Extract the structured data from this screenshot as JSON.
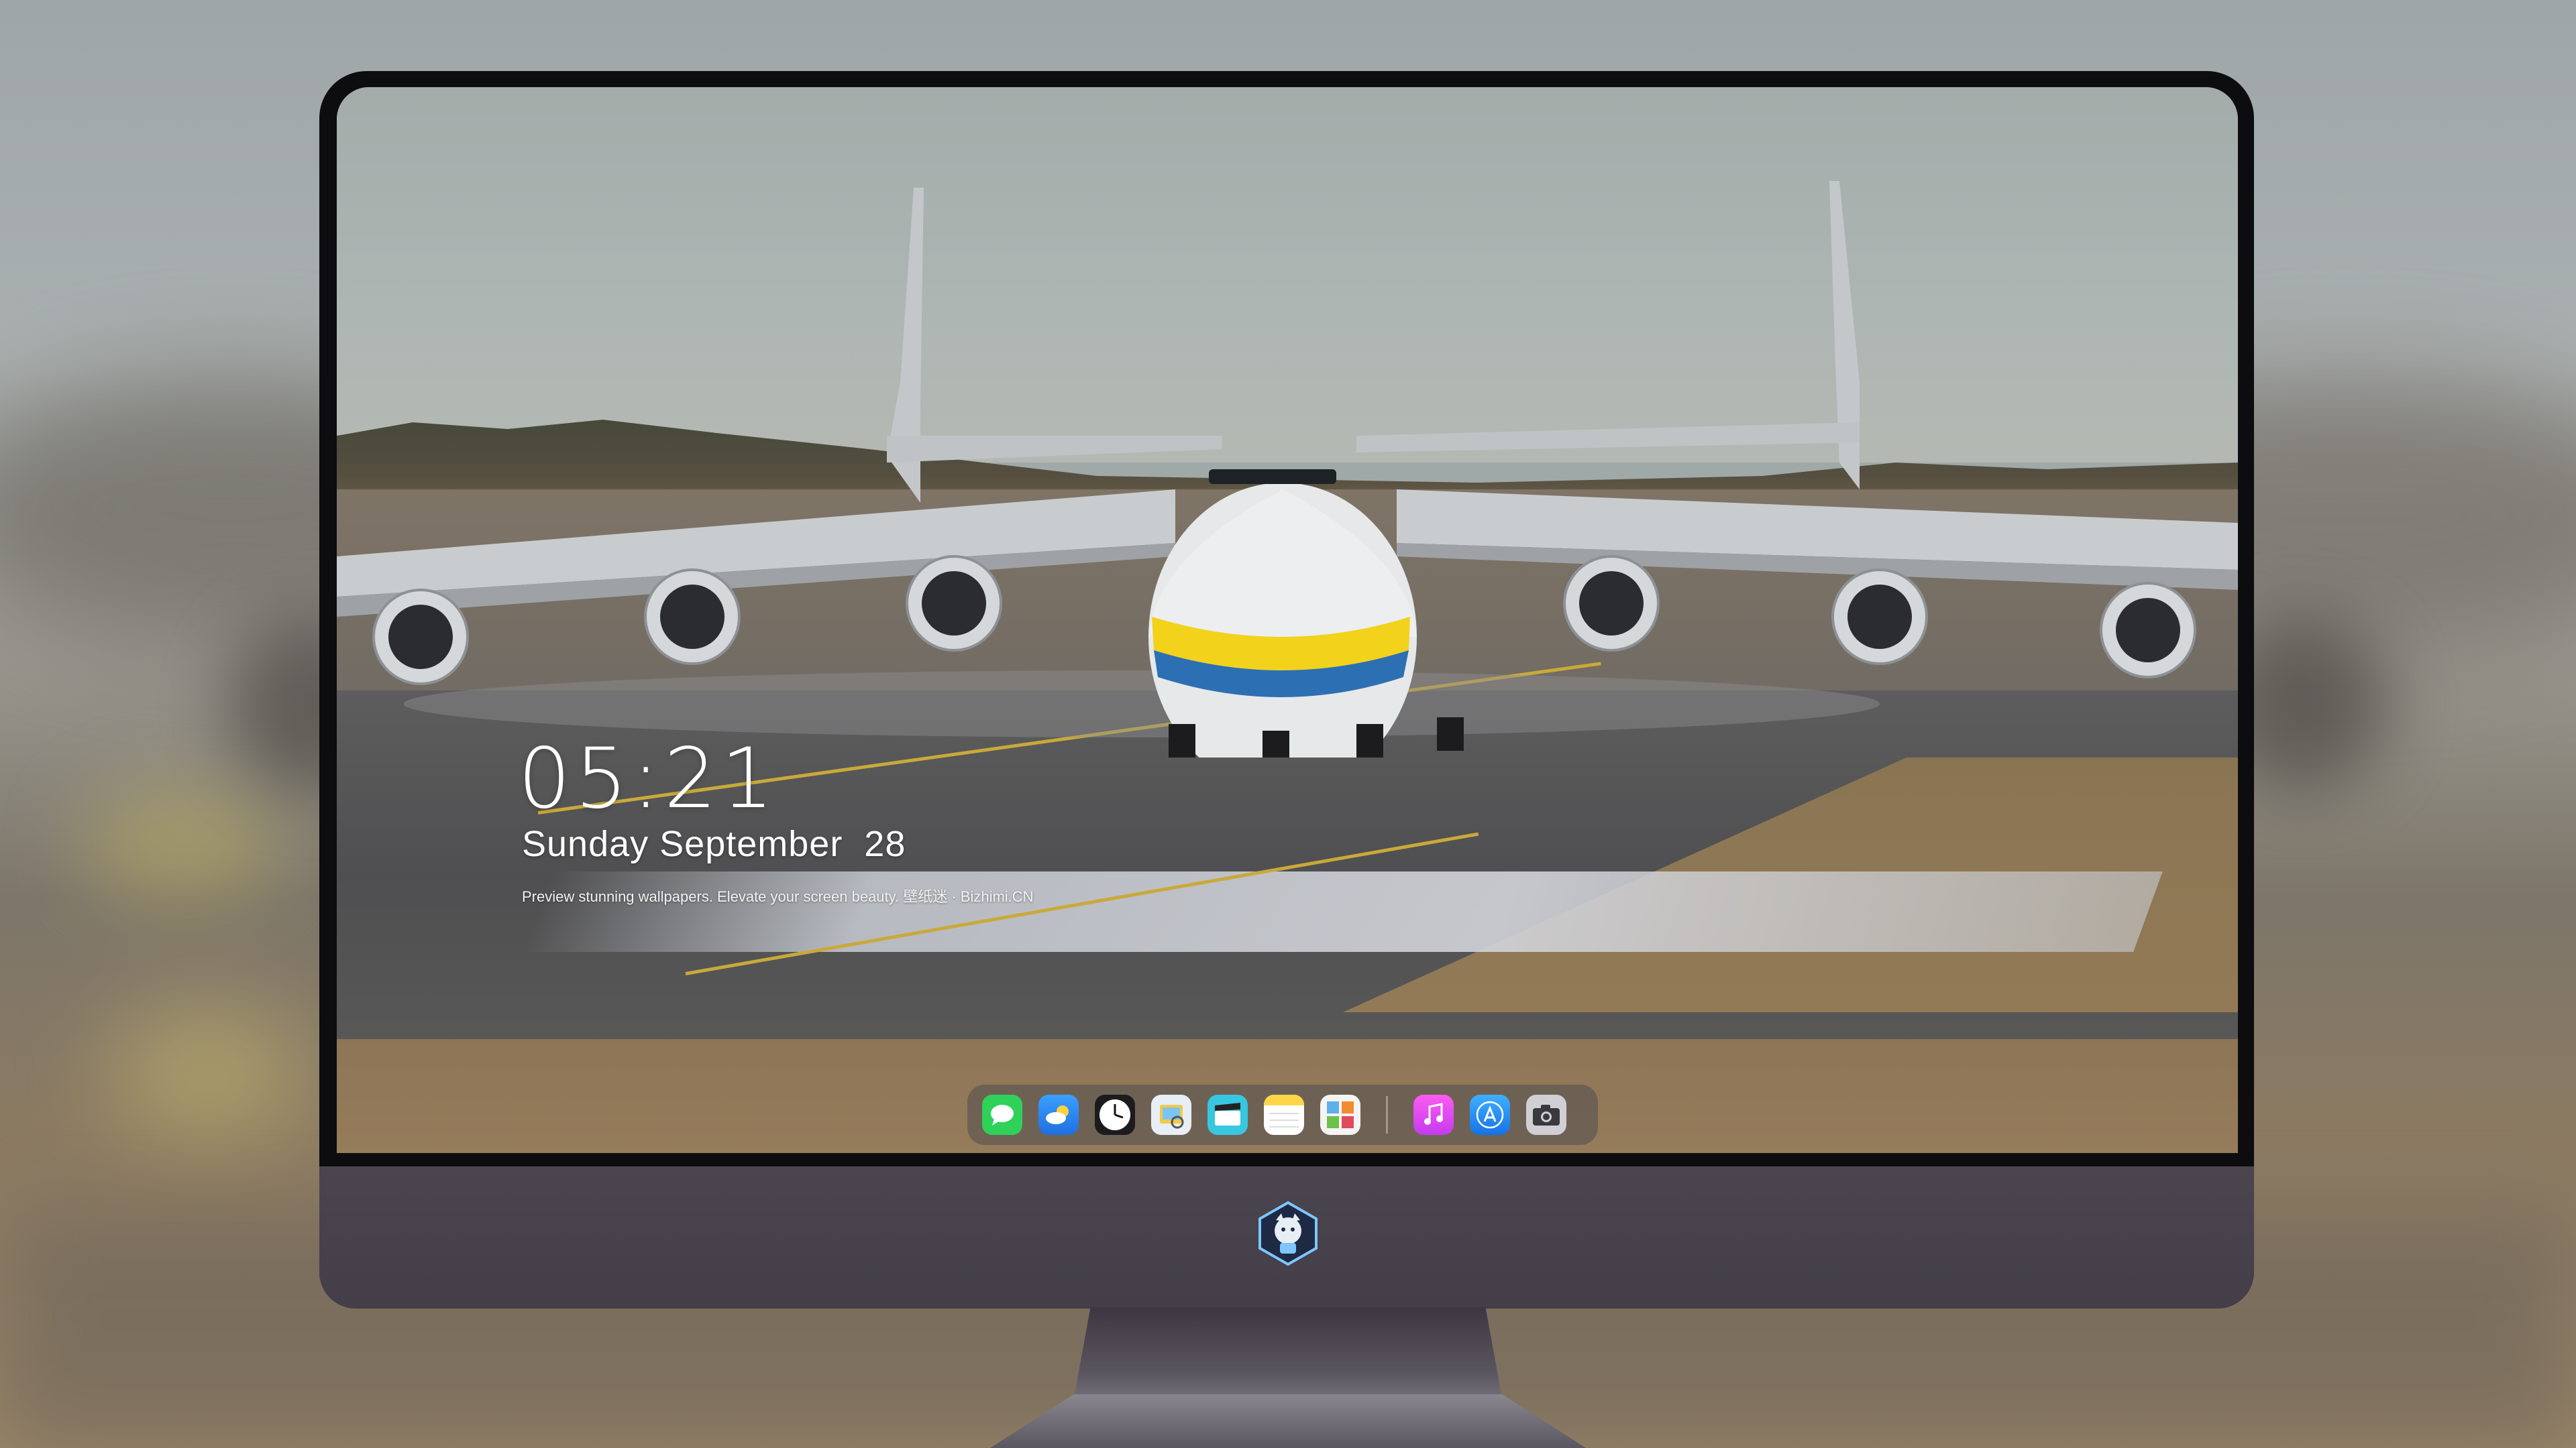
{
  "lockscreen": {
    "time": "05:21",
    "date": "Sunday September  28",
    "caption": "Preview stunning wallpapers. Elevate your screen beauty. 壁纸迷 · Bizhimi.CN"
  },
  "dock": {
    "apps": [
      {
        "name": "messages-icon",
        "color": "#2fd158"
      },
      {
        "name": "weather-icon",
        "color": "#3aa0ff"
      },
      {
        "name": "clock-icon",
        "color": "#ffffff"
      },
      {
        "name": "preview-icon",
        "color": "#f2c94c"
      },
      {
        "name": "clips-icon",
        "color": "#38c7e0"
      },
      {
        "name": "notes-icon",
        "color": "#ffd54a"
      },
      {
        "name": "photos-gallery-icon",
        "color": "#5fb0e8"
      },
      {
        "name": "music-icon",
        "color": "#e040fb"
      },
      {
        "name": "app-store-icon",
        "color": "#1e90ff"
      },
      {
        "name": "camera-icon",
        "color": "#8e8e93"
      }
    ]
  },
  "colors": {
    "monitor_bezel": "#0d0d10",
    "monitor_chin": "#48434c",
    "text": "#ffffff"
  }
}
